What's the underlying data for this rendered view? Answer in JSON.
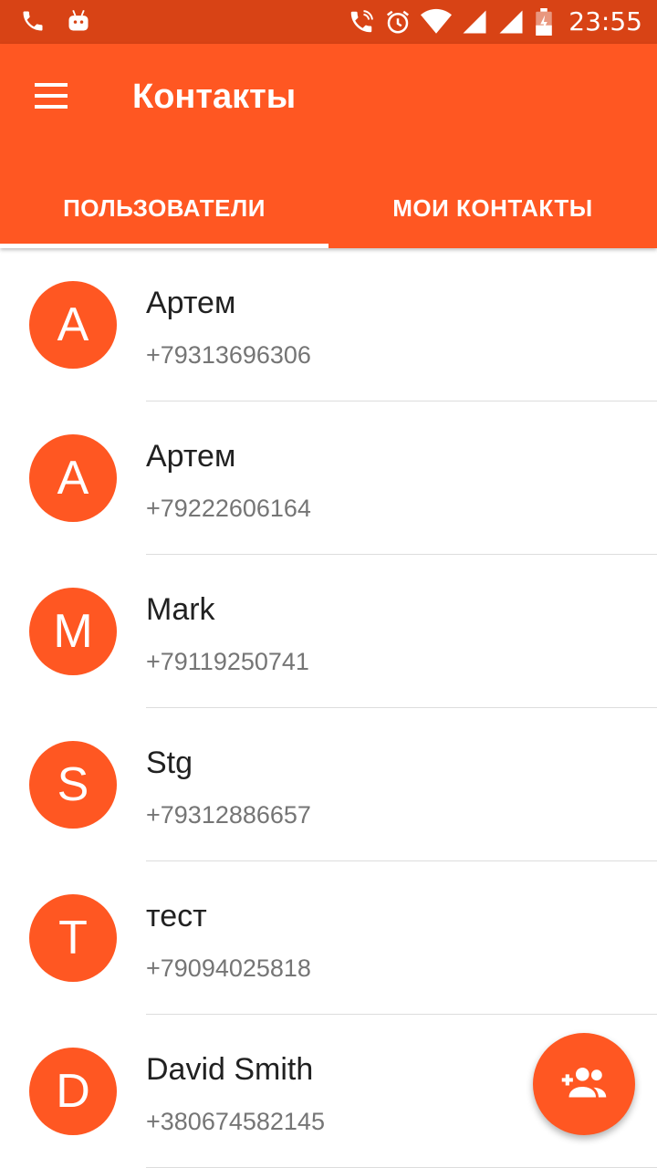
{
  "status_bar": {
    "time": "23:55",
    "left_icons": [
      "phone-icon",
      "android-icon"
    ],
    "right_icons": [
      "wifi-call-icon",
      "alarm-icon",
      "wifi-icon",
      "signal-icon",
      "signal-icon",
      "battery-charging-icon"
    ]
  },
  "app_bar": {
    "title": "Контакты",
    "menu_icon": "hamburger-menu-icon",
    "color": "#ff5722",
    "status_color": "#d84315"
  },
  "tabs": [
    {
      "label": "ПОЛЬЗОВАТЕЛИ",
      "active": true
    },
    {
      "label": "МОИ КОНТАКТЫ",
      "active": false
    }
  ],
  "contacts": [
    {
      "initial": "А",
      "name": "Артем",
      "phone": "+79313696306"
    },
    {
      "initial": "А",
      "name": "Артем",
      "phone": "+79222606164"
    },
    {
      "initial": "M",
      "name": "Mark",
      "phone": "+79119250741"
    },
    {
      "initial": "S",
      "name": "Stg",
      "phone": "+79312886657"
    },
    {
      "initial": "T",
      "name": "тест",
      "phone": "+79094025818"
    },
    {
      "initial": "D",
      "name": "David Smith",
      "phone": "+380674582145"
    }
  ],
  "fab": {
    "icon": "add-contact-icon"
  }
}
